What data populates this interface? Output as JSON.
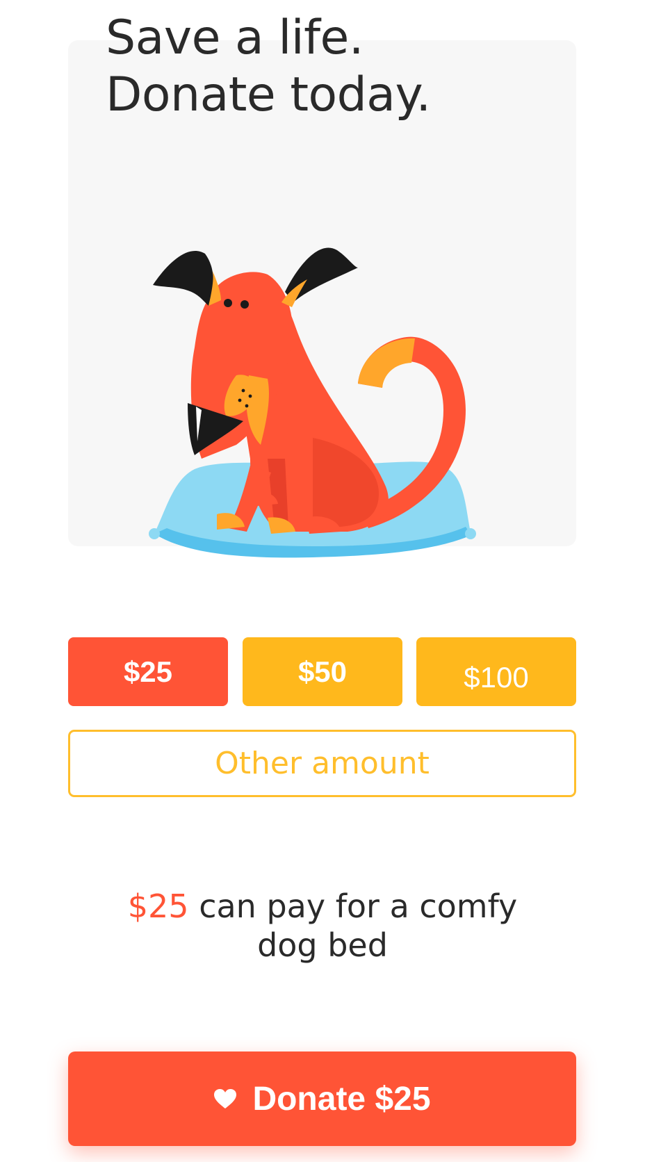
{
  "header": {
    "headline_line1": "Save a life.",
    "headline_line2": "Donate today."
  },
  "illustration": {
    "icon": "dog-on-pillow-illustration"
  },
  "amounts": {
    "options": [
      "$25",
      "$50",
      "$100"
    ],
    "selected": "$25",
    "other_label": "Other amount"
  },
  "impact": {
    "amount": "$25",
    "text": "can pay for a comfy dog bed"
  },
  "donate": {
    "label": "Donate $25",
    "icon": "heart-icon"
  },
  "colors": {
    "accent": "#ff5436",
    "secondary": "#ffb81c",
    "text": "#2a2a2a",
    "card": "#f7f7f7",
    "pillow": "#8dd9f3"
  }
}
